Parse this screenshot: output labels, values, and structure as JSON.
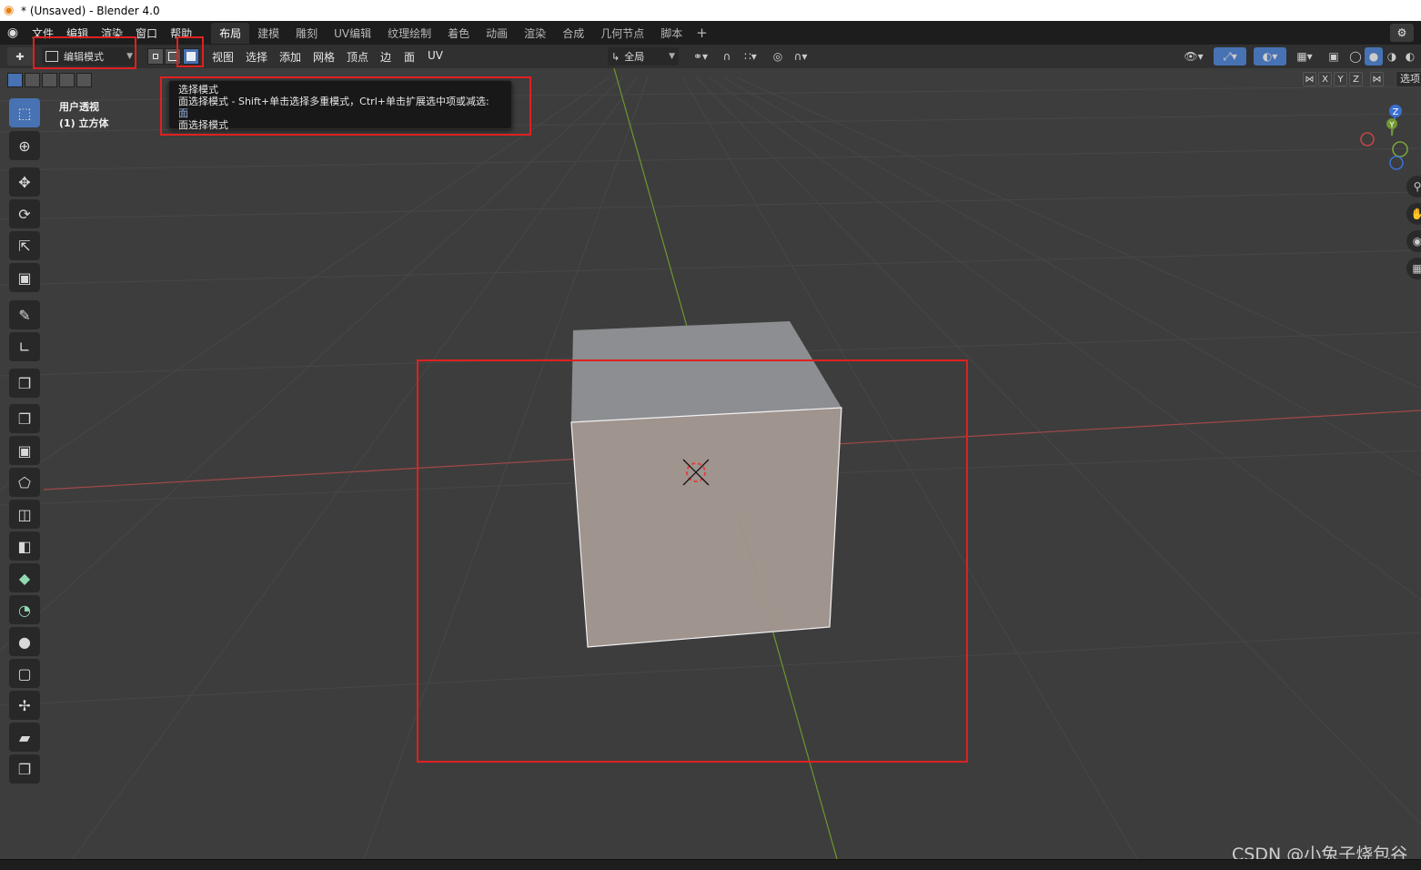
{
  "window": {
    "title": "* (Unsaved) - Blender 4.0"
  },
  "topbar": {
    "menus": [
      "文件",
      "编辑",
      "渲染",
      "窗口",
      "帮助"
    ],
    "workspaces": [
      "布局",
      "建模",
      "雕刻",
      "UV编辑",
      "纹理绘制",
      "着色",
      "动画",
      "渲染",
      "合成",
      "几何节点",
      "脚本"
    ],
    "active_workspace": "布局",
    "add_workspace": "+"
  },
  "viewport_header": {
    "mode": "编辑模式",
    "menus": [
      "视图",
      "选择",
      "添加",
      "网格",
      "顶点",
      "边",
      "面",
      "UV"
    ],
    "transform_orientation": "全局",
    "active_select_mode": "face"
  },
  "axis_toggles": [
    "X",
    "Y",
    "Z"
  ],
  "options_label": "选项",
  "viewport": {
    "view_name": "用户透视",
    "object_name": "(1) 立方体"
  },
  "tooltip": {
    "title": "选择模式",
    "description": "面选择模式 - Shift+单击选择多重模式，Ctrl+单击扩展选中项或减选:",
    "highlight": "面",
    "python_hint": "面选择模式"
  },
  "gizmo": {
    "axes": [
      "Z",
      "Y"
    ]
  },
  "watermark": "CSDN @小兔子烧包谷",
  "colors": {
    "accent": "#4772b3",
    "annotation": "#e02020",
    "x_axis": "#b34a4a",
    "y_axis": "#7aa33a",
    "cube_top": "#8a8c8f",
    "cube_front": "#a0948f"
  },
  "icons": {
    "tools": [
      "select-box-icon",
      "cursor-icon",
      "move-icon",
      "rotate-icon",
      "scale-icon",
      "transform-icon",
      "annotate-icon",
      "measure-icon",
      "add-cube-icon",
      "extrude-icon",
      "inset-icon",
      "bevel-icon",
      "loop-cut-icon",
      "knife-icon",
      "poly-build-icon",
      "spin-icon",
      "smooth-icon",
      "edge-slide-icon",
      "shrink-fatten-icon",
      "shear-icon",
      "rip-icon"
    ]
  }
}
